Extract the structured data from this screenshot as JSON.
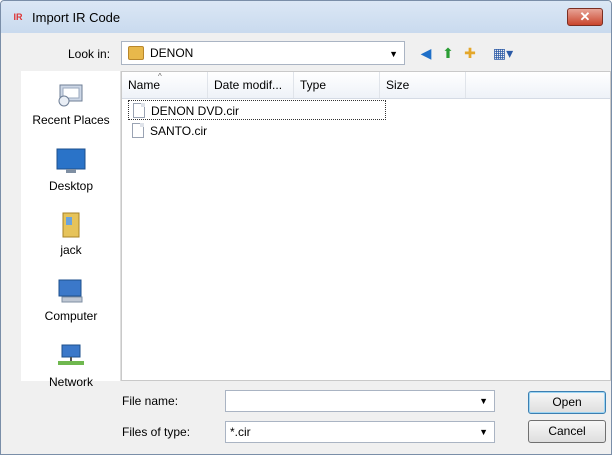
{
  "window": {
    "title": "Import IR Code",
    "close_glyph": "✕",
    "app_icon": "IR"
  },
  "toolbar": {
    "lookin_label": "Look in:",
    "lookin_value": "DENON",
    "icons": [
      "back-icon",
      "up-folder-icon",
      "new-folder-icon",
      "views-menu-icon"
    ]
  },
  "places": [
    {
      "label": "Recent Places",
      "icon": "recent-places-icon"
    },
    {
      "label": "Desktop",
      "icon": "desktop-icon"
    },
    {
      "label": "jack",
      "icon": "user-folder-icon"
    },
    {
      "label": "Computer",
      "icon": "computer-icon"
    },
    {
      "label": "Network",
      "icon": "network-icon"
    }
  ],
  "filelist": {
    "columns": [
      "Name",
      "Date modif...",
      "Type",
      "Size"
    ],
    "files": [
      "DENON DVD.cir",
      "SANTO.cir"
    ]
  },
  "bottom": {
    "filename_label": "File name:",
    "filename_value": "",
    "filetype_label": "Files of type:",
    "filetype_value": "*.cir",
    "open_label": "Open",
    "cancel_label": "Cancel"
  }
}
